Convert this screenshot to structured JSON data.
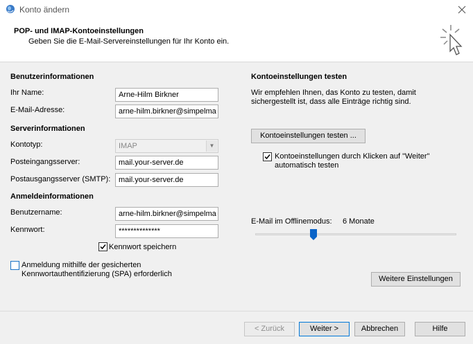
{
  "window": {
    "title": "Konto ändern"
  },
  "header": {
    "title": "POP- und IMAP-Kontoeinstellungen",
    "subtitle": "Geben Sie die E-Mail-Servereinstellungen für Ihr Konto ein."
  },
  "user_info": {
    "section": "Benutzerinformationen",
    "name_label": "Ihr Name:",
    "name_value": "Arne-Hilm Birkner",
    "email_label": "E-Mail-Adresse:",
    "email_value": "arne-hilm.birkner@simpelma"
  },
  "server_info": {
    "section": "Serverinformationen",
    "type_label": "Kontotyp:",
    "type_value": "IMAP",
    "incoming_label": "Posteingangsserver:",
    "incoming_value": "mail.your-server.de",
    "outgoing_label": "Postausgangsserver (SMTP):",
    "outgoing_value": "mail.your-server.de"
  },
  "logon_info": {
    "section": "Anmeldeinformationen",
    "username_label": "Benutzername:",
    "username_value": "arne-hilm.birkner@simpelma",
    "password_label": "Kennwort:",
    "password_value": "**************",
    "remember_label": "Kennwort speichern",
    "remember_checked": true,
    "spa_label_line1": "Anmeldung mithilfe der gesicherten",
    "spa_label_line2": "Kennwortauthentifizierung (SPA) erforderlich",
    "spa_checked": false
  },
  "test_settings": {
    "section": "Kontoeinstellungen testen",
    "desc_line1": "Wir empfehlen Ihnen, das Konto zu testen, damit",
    "desc_line2": "sichergestellt ist, dass alle Einträge richtig sind.",
    "test_button": "Kontoeinstellungen testen ...",
    "auto_test_line1": "Kontoeinstellungen durch Klicken auf \"Weiter\"",
    "auto_test_line2": "automatisch testen",
    "auto_test_checked": true
  },
  "offline": {
    "label": "E-Mail im Offlinemodus:",
    "value": "6 Monate",
    "slider_fraction": 0.29
  },
  "more_settings_button": "Weitere Einstellungen",
  "footer": {
    "back": "< Zurück",
    "next": "Weiter >",
    "cancel": "Abbrechen",
    "help": "Hilfe"
  },
  "icons": {
    "app": "outlook-globe-icon",
    "close": "close-icon",
    "cursor": "wizard-cursor-icon",
    "dropdown": "chevron-down-icon",
    "check": "checkmark-icon"
  },
  "colors": {
    "accent": "#1a73c7",
    "slider_thumb": "#0a64c8"
  }
}
